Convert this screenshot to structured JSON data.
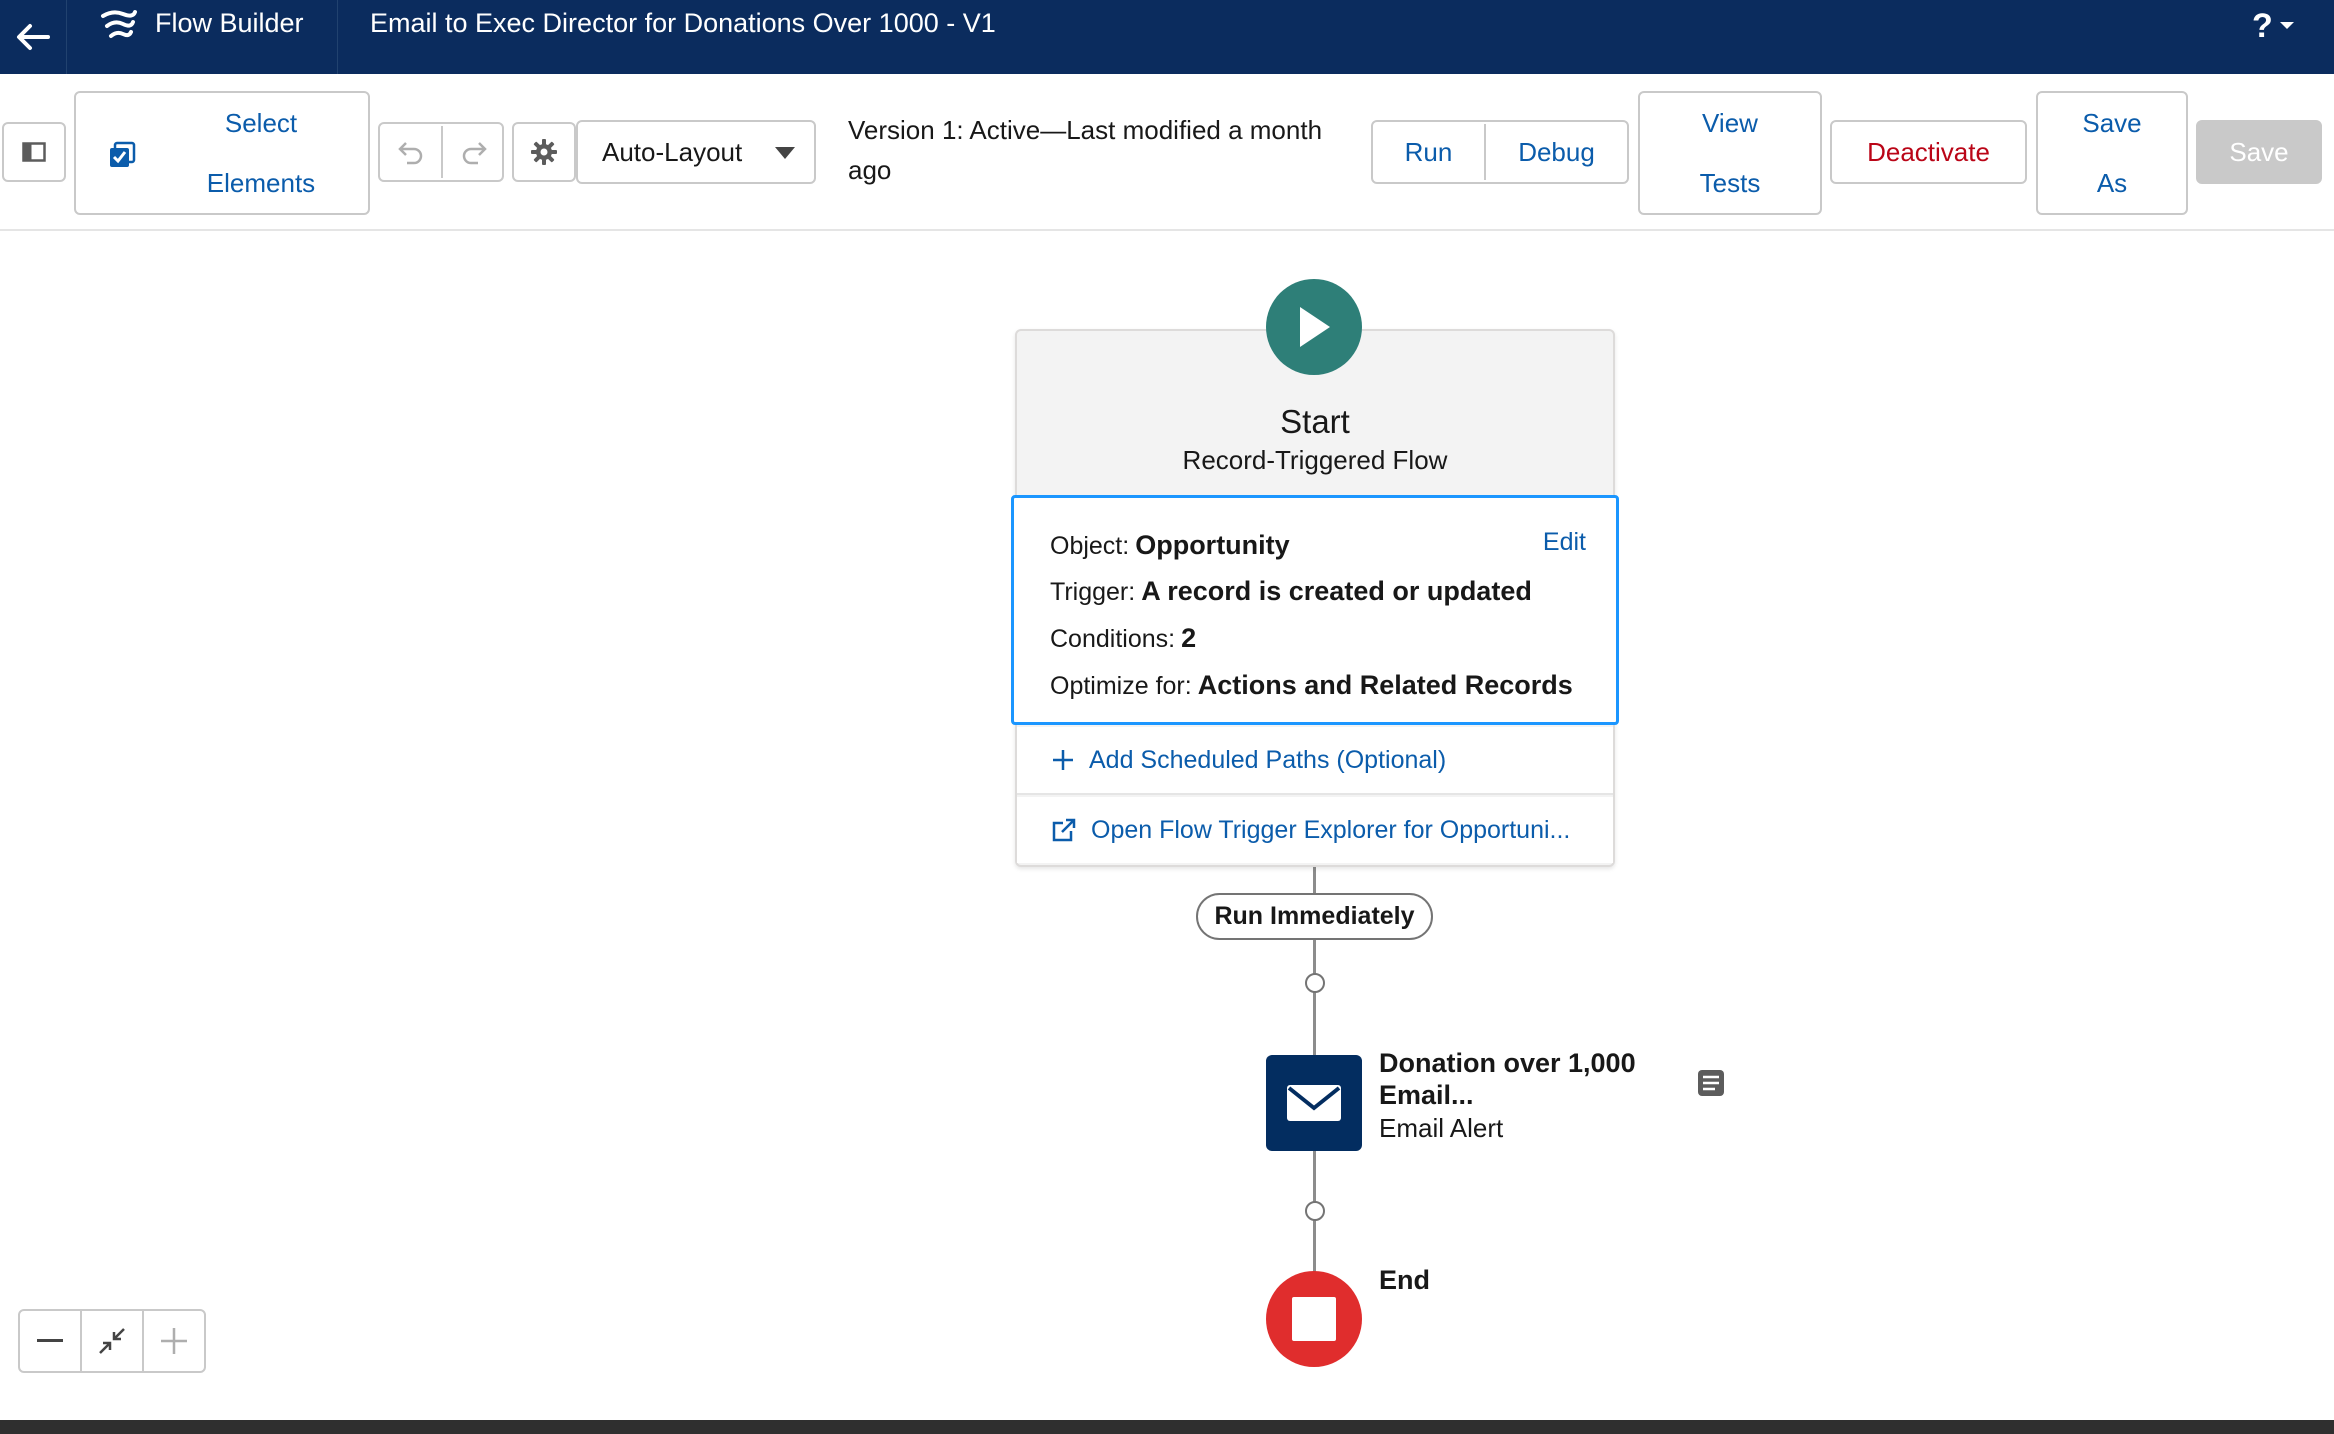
{
  "header": {
    "app_name": "Flow Builder",
    "flow_title": "Email to Exec Director for Donations Over 1000 - V1",
    "help_label": "?"
  },
  "toolbar": {
    "select_elements_line1": "Select",
    "select_elements_line2": "Elements",
    "layout_mode": "Auto-Layout",
    "version_status": "Version 1: Active—Last modified a month ago",
    "run_label": "Run",
    "debug_label": "Debug",
    "view_tests_line1": "View",
    "view_tests_line2": "Tests",
    "deactivate_label": "Deactivate",
    "save_as_line1": "Save",
    "save_as_line2": "As",
    "save_label": "Save"
  },
  "canvas": {
    "start": {
      "title": "Start",
      "subtitle": "Record-Triggered Flow",
      "object_label": "Object:",
      "object_value": "Opportunity",
      "edit_label": "Edit",
      "trigger_label": "Trigger:",
      "trigger_value": "A record is created or updated",
      "conditions_label": "Conditions:",
      "conditions_value": "2",
      "optimize_label": "Optimize for:",
      "optimize_value": "Actions and Related Records",
      "add_paths_label": "Add Scheduled Paths (Optional)",
      "trigger_explorer_label": "Open Flow Trigger Explorer for Opportuni..."
    },
    "path_label": "Run Immediately",
    "action": {
      "title_line1": "Donation over 1,000",
      "title_line2": "Email...",
      "type": "Email Alert"
    },
    "end_label": "End"
  },
  "colors": {
    "header_bg": "#0b2c5e",
    "link_blue": "#0b5cab",
    "start_green": "#2e7f78",
    "action_navy": "#032d60",
    "end_red": "#e02d2d",
    "selection_blue": "#1b96ff",
    "deactivate_red": "#ba0517"
  },
  "icons": [
    "back-arrow-icon",
    "flow-builder-logo-icon",
    "help-icon",
    "chevron-down-icon",
    "panel-toggle-icon",
    "select-checkbox-icon",
    "undo-icon",
    "redo-icon",
    "gear-icon",
    "dropdown-triangle-icon",
    "play-icon",
    "plus-icon",
    "external-link-icon",
    "envelope-icon",
    "note-icon",
    "stop-icon",
    "zoom-out-icon",
    "fit-view-icon",
    "zoom-in-icon"
  ]
}
